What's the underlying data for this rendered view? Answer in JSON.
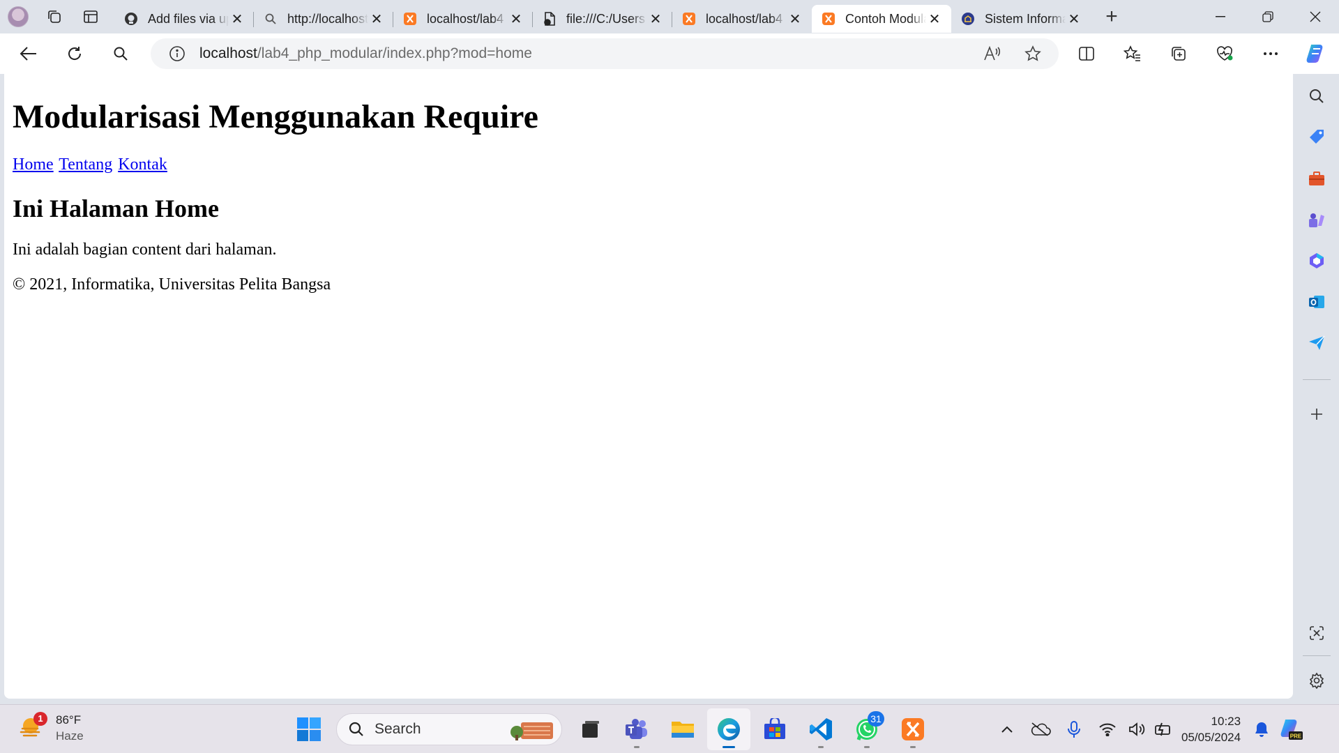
{
  "browser": {
    "tabs": [
      {
        "title": "Add files via upload",
        "favicon": "github-icon",
        "active": false
      },
      {
        "title": "http://localhost",
        "favicon": "search-icon",
        "active": false
      },
      {
        "title": "localhost/lab4",
        "favicon": "xampp-icon",
        "active": false
      },
      {
        "title": "file:///C:/Users",
        "favicon": "file-icon",
        "active": false
      },
      {
        "title": "localhost/lab4",
        "favicon": "xampp-icon",
        "active": false
      },
      {
        "title": "Contoh Modularisasi",
        "favicon": "xampp-icon",
        "active": true
      },
      {
        "title": "Sistem Informasi",
        "favicon": "campus-icon",
        "active": false
      }
    ],
    "address": {
      "host": "localhost",
      "path": "/lab4_php_modular/index.php?mod=home"
    }
  },
  "page": {
    "heading": "Modularisasi Menggunakan Require",
    "nav": {
      "home": "Home",
      "about": "Tentang",
      "contact": "Kontak"
    },
    "content_title": "Ini Halaman Home",
    "content_text": "Ini adalah bagian content dari halaman.",
    "footer": "© 2021, Informatika, Universitas Pelita Bangsa"
  },
  "taskbar": {
    "weather": {
      "temp": "86°F",
      "condition": "Haze",
      "badge": "1"
    },
    "search_label": "Search",
    "whatsapp_badge": "31",
    "time": "10:23",
    "date": "05/05/2024"
  },
  "colors": {
    "accent": "#0067c0",
    "link": "#0000ee",
    "xampp": "#fb7a24"
  }
}
